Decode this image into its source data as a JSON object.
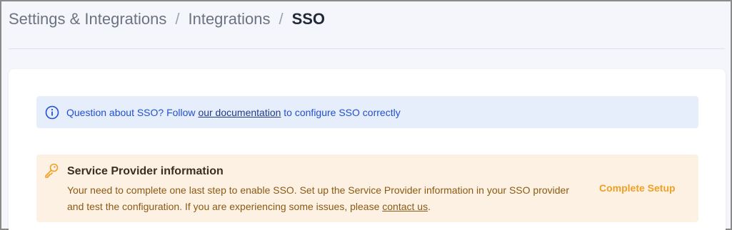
{
  "breadcrumb": {
    "items": [
      "Settings & Integrations",
      "Integrations"
    ],
    "separator": "/",
    "current": "SSO"
  },
  "info_alert": {
    "icon": "info-icon",
    "text_before": "Question about SSO? Follow ",
    "link_label": "our documentation",
    "text_after": " to configure SSO correctly"
  },
  "warning_alert": {
    "icon": "key-icon",
    "title": "Service Provider information",
    "body_before": "Your need to complete one last step to enable SSO. Set up the Service Provider information in your SSO provider and test the configuration. If you are experiencing some issues, please ",
    "link_label": "contact us",
    "body_after": ".",
    "action_label": "Complete Setup"
  },
  "colors": {
    "info_bg": "#e6eefc",
    "info_text": "#1f4fd6",
    "warning_bg": "#fdf1e3",
    "warning_accent": "#f0a024"
  }
}
